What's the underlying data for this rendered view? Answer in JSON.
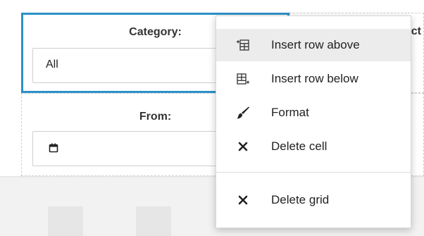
{
  "filters": {
    "category": {
      "label": "Category:",
      "value": "All"
    },
    "from": {
      "label": "From:",
      "value": ""
    },
    "clipped_label": "uct"
  },
  "context_menu": {
    "items": [
      {
        "label": "Insert row above",
        "icon": "insert-row-above-icon",
        "hovered": true
      },
      {
        "label": "Insert row below",
        "icon": "insert-row-below-icon",
        "hovered": false
      },
      {
        "label": "Format",
        "icon": "paint-brush-icon",
        "hovered": false
      },
      {
        "label": "Delete cell",
        "icon": "close-icon",
        "hovered": false
      },
      {
        "label": "Delete grid",
        "icon": "close-icon",
        "hovered": false
      }
    ]
  },
  "colors": {
    "selection_border": "#2b91c8",
    "menu_hover": "#ececec"
  }
}
